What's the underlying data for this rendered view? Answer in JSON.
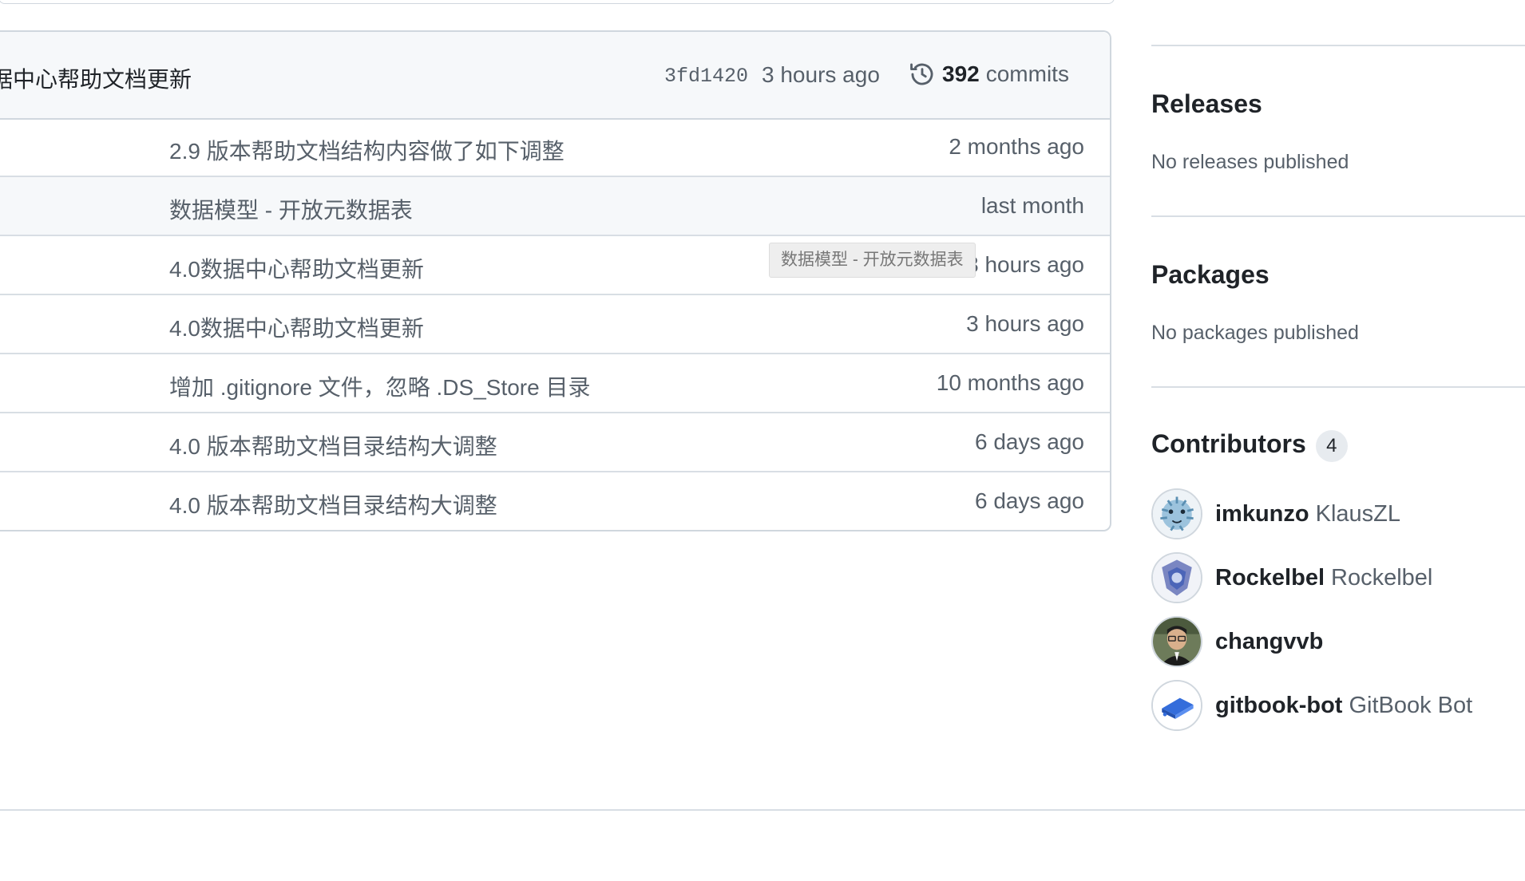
{
  "latest_commit": {
    "message": "据中心帮助文档更新",
    "sha": "3fd1420",
    "time": "3 hours ago",
    "commit_count": "392",
    "commits_label": "commits"
  },
  "files": [
    {
      "message": "2.9 版本帮助文档结构内容做了如下调整",
      "age": "2 months ago"
    },
    {
      "message": "数据模型 - 开放元数据表",
      "age": "last month"
    },
    {
      "message": "4.0数据中心帮助文档更新",
      "age": "3 hours ago"
    },
    {
      "message": "4.0数据中心帮助文档更新",
      "age": "3 hours ago"
    },
    {
      "message": "增加 .gitignore 文件，忽略 .DS_Store 目录",
      "age": "10 months ago"
    },
    {
      "message": "4.0 版本帮助文档目录结构大调整",
      "age": "6 days ago"
    },
    {
      "message": "4.0 版本帮助文档目录结构大调整",
      "age": "6 days ago"
    }
  ],
  "tooltip": "数据模型 - 开放元数据表",
  "sidebar": {
    "releases": {
      "title": "Releases",
      "subtitle": "No releases published"
    },
    "packages": {
      "title": "Packages",
      "subtitle": "No packages published"
    },
    "contributors": {
      "title": "Contributors",
      "count": "4",
      "list": [
        {
          "login": "imkunzo",
          "name": "KlausZL"
        },
        {
          "login": "Rockelbel",
          "name": "Rockelbel"
        },
        {
          "login": "changvvb",
          "name": ""
        },
        {
          "login": "gitbook-bot",
          "name": "GitBook Bot"
        }
      ]
    }
  },
  "colors": {
    "border": "#d0d7de",
    "header_bg": "#f6f8fa",
    "muted_text": "#57606a",
    "text": "#1f2328",
    "gitbook_blue": "#346ddb"
  }
}
